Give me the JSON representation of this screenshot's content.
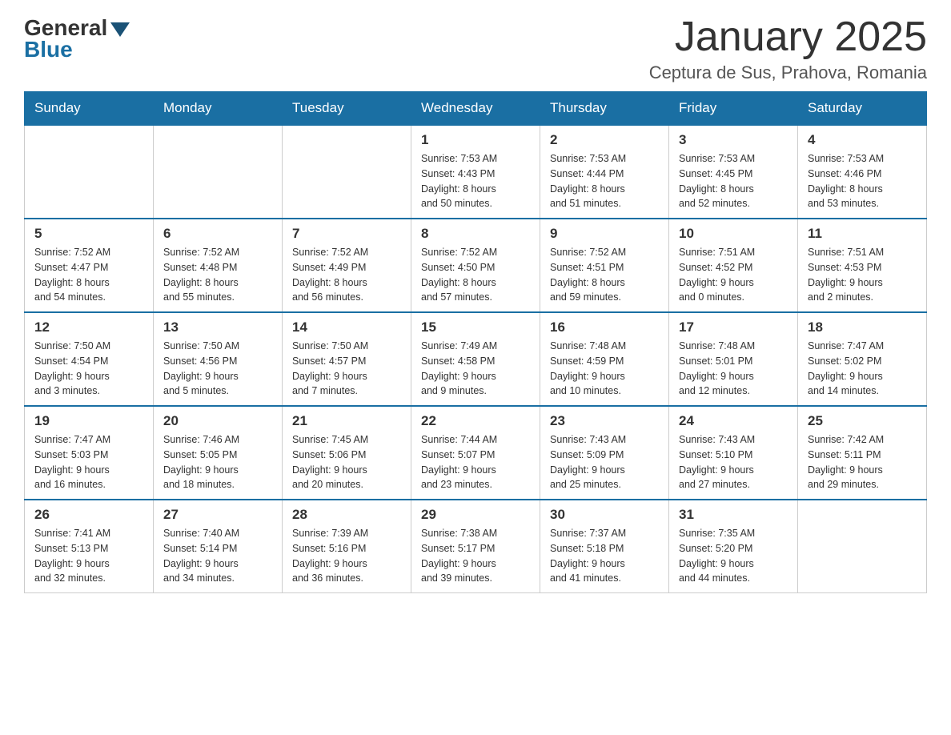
{
  "header": {
    "logo": {
      "general": "General",
      "blue": "Blue"
    },
    "title": "January 2025",
    "location": "Ceptura de Sus, Prahova, Romania"
  },
  "weekdays": [
    "Sunday",
    "Monday",
    "Tuesday",
    "Wednesday",
    "Thursday",
    "Friday",
    "Saturday"
  ],
  "weeks": [
    [
      {
        "day": "",
        "info": ""
      },
      {
        "day": "",
        "info": ""
      },
      {
        "day": "",
        "info": ""
      },
      {
        "day": "1",
        "info": "Sunrise: 7:53 AM\nSunset: 4:43 PM\nDaylight: 8 hours\nand 50 minutes."
      },
      {
        "day": "2",
        "info": "Sunrise: 7:53 AM\nSunset: 4:44 PM\nDaylight: 8 hours\nand 51 minutes."
      },
      {
        "day": "3",
        "info": "Sunrise: 7:53 AM\nSunset: 4:45 PM\nDaylight: 8 hours\nand 52 minutes."
      },
      {
        "day": "4",
        "info": "Sunrise: 7:53 AM\nSunset: 4:46 PM\nDaylight: 8 hours\nand 53 minutes."
      }
    ],
    [
      {
        "day": "5",
        "info": "Sunrise: 7:52 AM\nSunset: 4:47 PM\nDaylight: 8 hours\nand 54 minutes."
      },
      {
        "day": "6",
        "info": "Sunrise: 7:52 AM\nSunset: 4:48 PM\nDaylight: 8 hours\nand 55 minutes."
      },
      {
        "day": "7",
        "info": "Sunrise: 7:52 AM\nSunset: 4:49 PM\nDaylight: 8 hours\nand 56 minutes."
      },
      {
        "day": "8",
        "info": "Sunrise: 7:52 AM\nSunset: 4:50 PM\nDaylight: 8 hours\nand 57 minutes."
      },
      {
        "day": "9",
        "info": "Sunrise: 7:52 AM\nSunset: 4:51 PM\nDaylight: 8 hours\nand 59 minutes."
      },
      {
        "day": "10",
        "info": "Sunrise: 7:51 AM\nSunset: 4:52 PM\nDaylight: 9 hours\nand 0 minutes."
      },
      {
        "day": "11",
        "info": "Sunrise: 7:51 AM\nSunset: 4:53 PM\nDaylight: 9 hours\nand 2 minutes."
      }
    ],
    [
      {
        "day": "12",
        "info": "Sunrise: 7:50 AM\nSunset: 4:54 PM\nDaylight: 9 hours\nand 3 minutes."
      },
      {
        "day": "13",
        "info": "Sunrise: 7:50 AM\nSunset: 4:56 PM\nDaylight: 9 hours\nand 5 minutes."
      },
      {
        "day": "14",
        "info": "Sunrise: 7:50 AM\nSunset: 4:57 PM\nDaylight: 9 hours\nand 7 minutes."
      },
      {
        "day": "15",
        "info": "Sunrise: 7:49 AM\nSunset: 4:58 PM\nDaylight: 9 hours\nand 9 minutes."
      },
      {
        "day": "16",
        "info": "Sunrise: 7:48 AM\nSunset: 4:59 PM\nDaylight: 9 hours\nand 10 minutes."
      },
      {
        "day": "17",
        "info": "Sunrise: 7:48 AM\nSunset: 5:01 PM\nDaylight: 9 hours\nand 12 minutes."
      },
      {
        "day": "18",
        "info": "Sunrise: 7:47 AM\nSunset: 5:02 PM\nDaylight: 9 hours\nand 14 minutes."
      }
    ],
    [
      {
        "day": "19",
        "info": "Sunrise: 7:47 AM\nSunset: 5:03 PM\nDaylight: 9 hours\nand 16 minutes."
      },
      {
        "day": "20",
        "info": "Sunrise: 7:46 AM\nSunset: 5:05 PM\nDaylight: 9 hours\nand 18 minutes."
      },
      {
        "day": "21",
        "info": "Sunrise: 7:45 AM\nSunset: 5:06 PM\nDaylight: 9 hours\nand 20 minutes."
      },
      {
        "day": "22",
        "info": "Sunrise: 7:44 AM\nSunset: 5:07 PM\nDaylight: 9 hours\nand 23 minutes."
      },
      {
        "day": "23",
        "info": "Sunrise: 7:43 AM\nSunset: 5:09 PM\nDaylight: 9 hours\nand 25 minutes."
      },
      {
        "day": "24",
        "info": "Sunrise: 7:43 AM\nSunset: 5:10 PM\nDaylight: 9 hours\nand 27 minutes."
      },
      {
        "day": "25",
        "info": "Sunrise: 7:42 AM\nSunset: 5:11 PM\nDaylight: 9 hours\nand 29 minutes."
      }
    ],
    [
      {
        "day": "26",
        "info": "Sunrise: 7:41 AM\nSunset: 5:13 PM\nDaylight: 9 hours\nand 32 minutes."
      },
      {
        "day": "27",
        "info": "Sunrise: 7:40 AM\nSunset: 5:14 PM\nDaylight: 9 hours\nand 34 minutes."
      },
      {
        "day": "28",
        "info": "Sunrise: 7:39 AM\nSunset: 5:16 PM\nDaylight: 9 hours\nand 36 minutes."
      },
      {
        "day": "29",
        "info": "Sunrise: 7:38 AM\nSunset: 5:17 PM\nDaylight: 9 hours\nand 39 minutes."
      },
      {
        "day": "30",
        "info": "Sunrise: 7:37 AM\nSunset: 5:18 PM\nDaylight: 9 hours\nand 41 minutes."
      },
      {
        "day": "31",
        "info": "Sunrise: 7:35 AM\nSunset: 5:20 PM\nDaylight: 9 hours\nand 44 minutes."
      },
      {
        "day": "",
        "info": ""
      }
    ]
  ]
}
